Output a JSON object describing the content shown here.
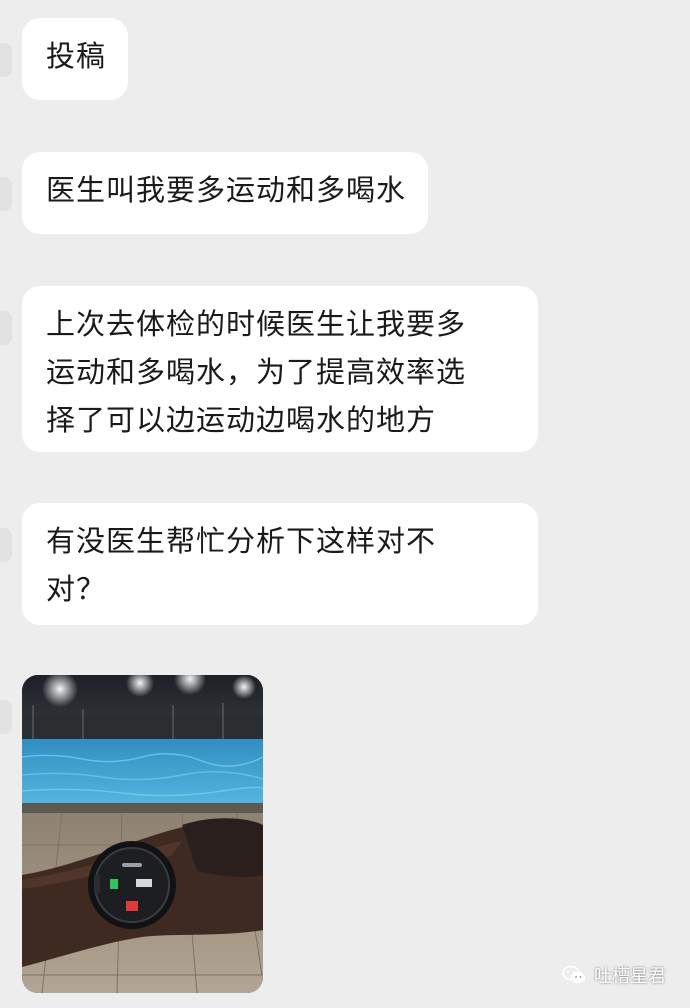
{
  "messages": [
    {
      "lines": [
        "投稿"
      ]
    },
    {
      "lines": [
        "医生叫我要多运动和多喝水"
      ]
    },
    {
      "lines": [
        "上次去体检的时候医生让我要多",
        "运动和多喝水，为了提高效率选",
        "择了可以边运动边喝水的地方"
      ]
    },
    {
      "lines": [
        "有没医生帮忙分析下这样对不",
        "对？"
      ]
    }
  ],
  "image_message": {
    "type": "photo",
    "icon": "photo-icon"
  },
  "watermark": {
    "text": "吐槽星君",
    "icon": "wechat-icon"
  },
  "colors": {
    "background": "#ededed",
    "bubble": "#ffffff",
    "text": "#1a1a1a"
  }
}
